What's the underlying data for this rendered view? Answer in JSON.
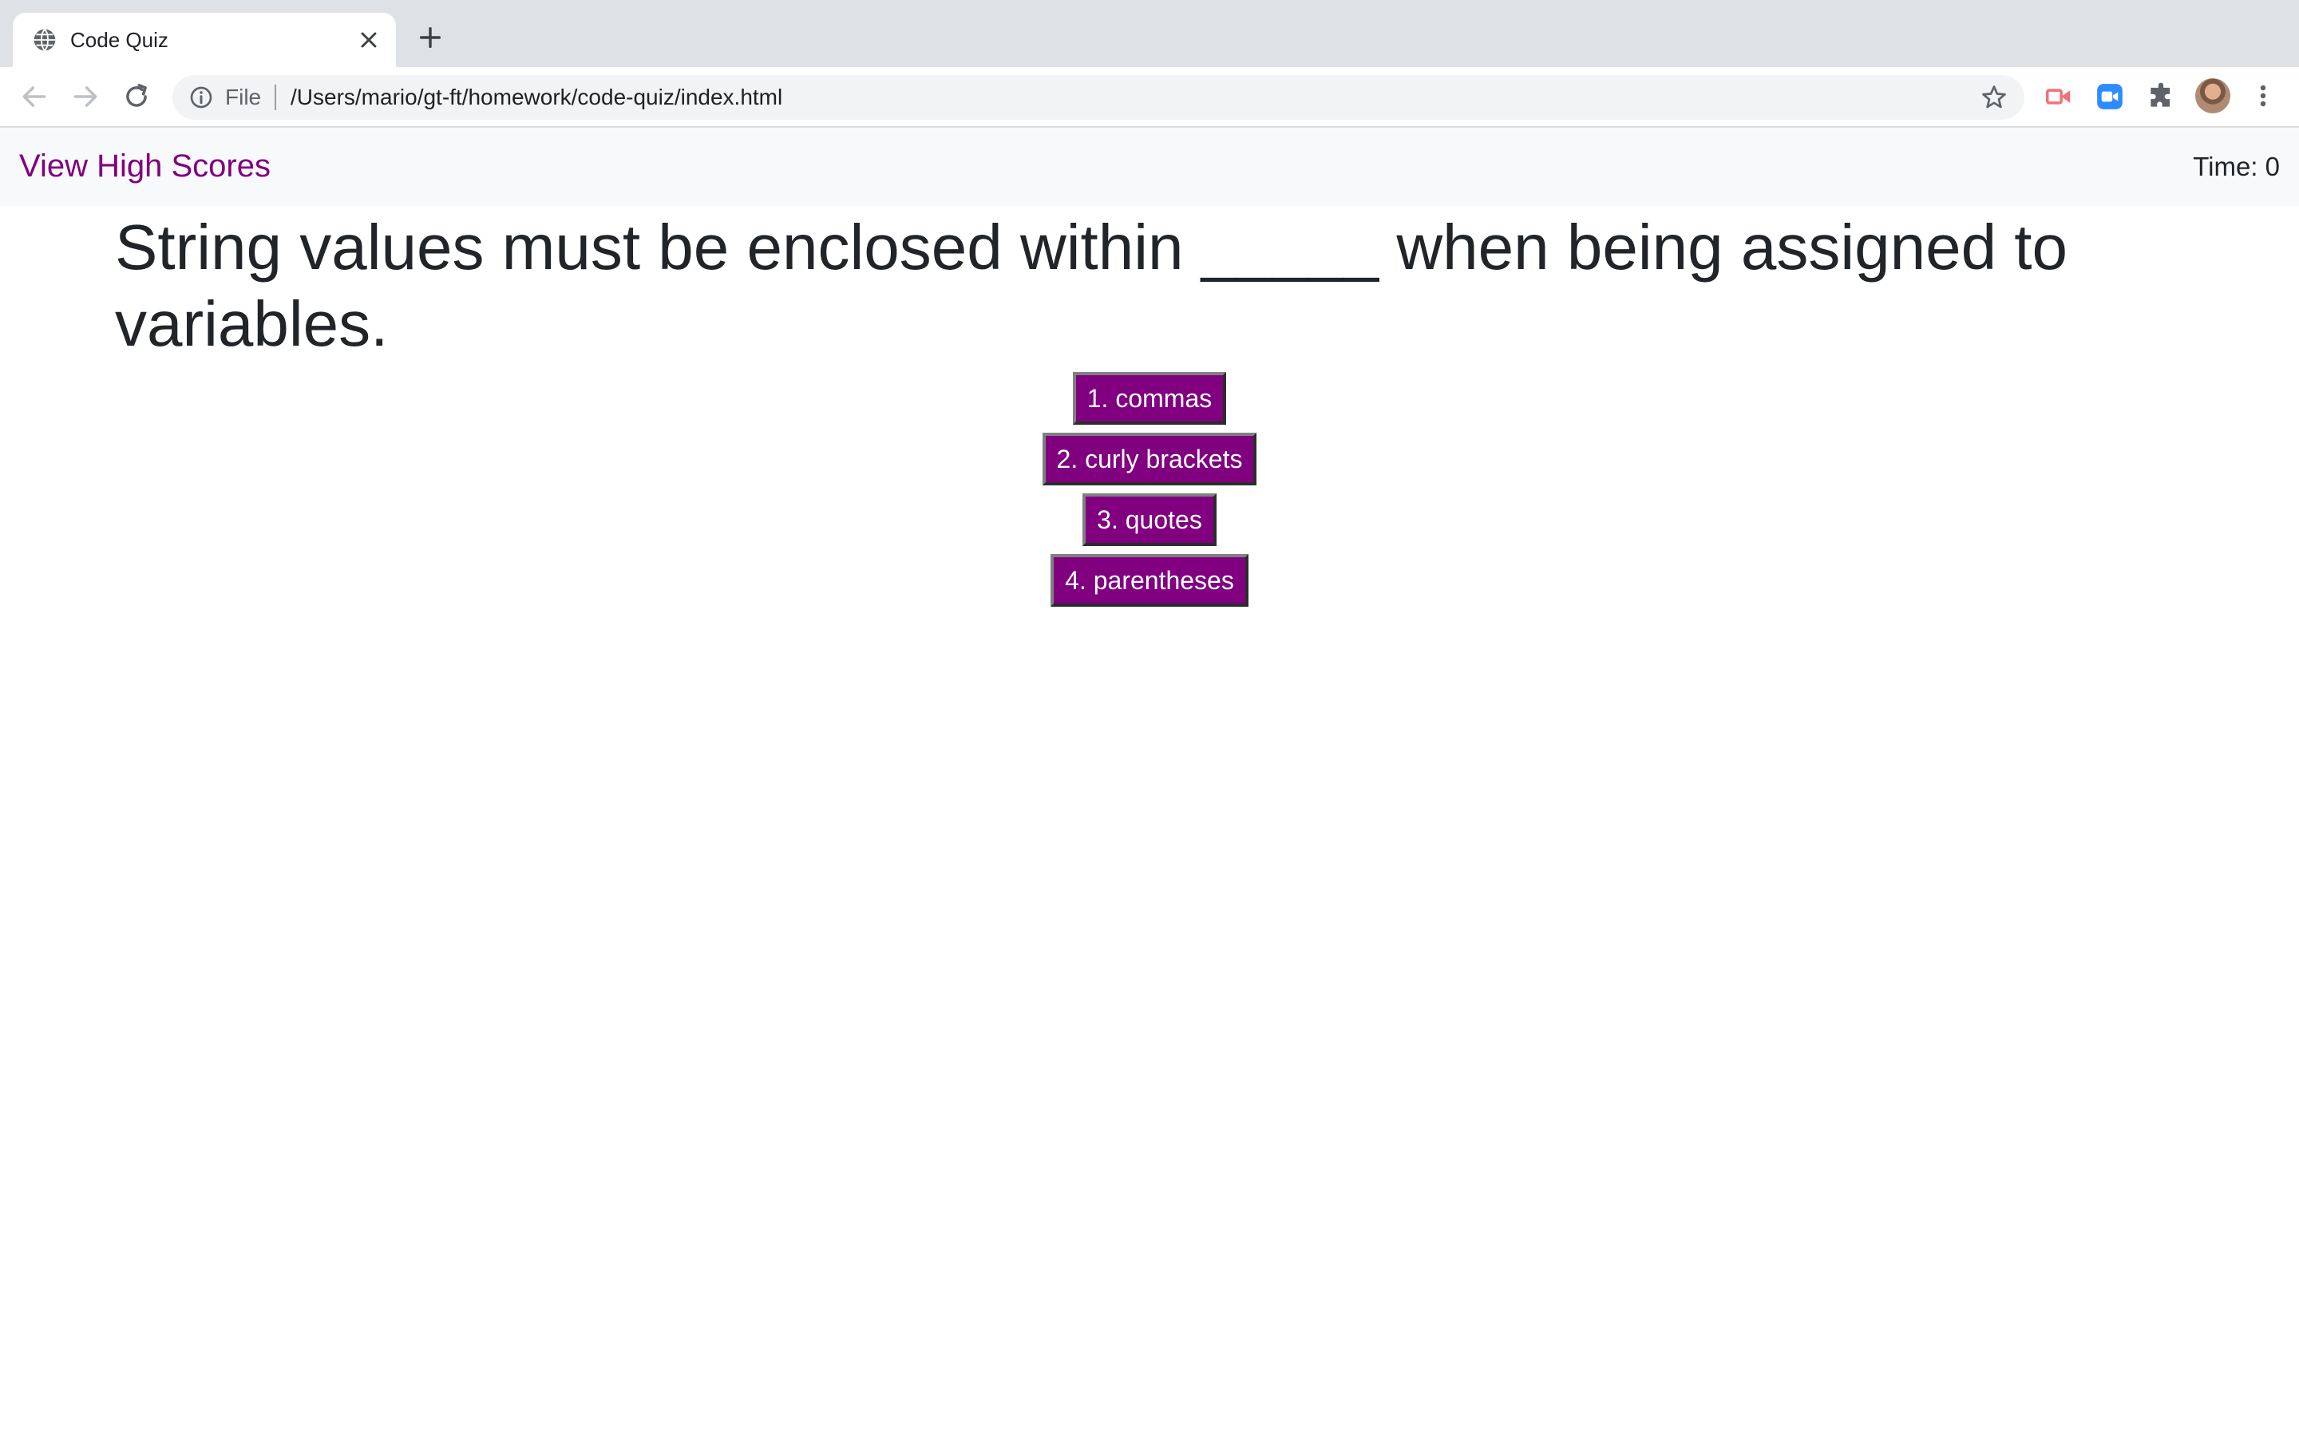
{
  "browser": {
    "tab_title": "Code Quiz",
    "url_scheme": "File",
    "url": "/Users/mario/gt-ft/homework/code-quiz/index.html",
    "icons": [
      "globe-icon",
      "close-icon",
      "plus-icon",
      "back-arrow-icon",
      "forward-arrow-icon",
      "reload-icon",
      "info-icon",
      "star-icon",
      "screencast-extension-icon",
      "zoom-extension-icon",
      "puzzle-extension-icon",
      "avatar",
      "more-vert-icon"
    ]
  },
  "header": {
    "high_scores_label": "View High Scores",
    "timer_label": "Time: 0"
  },
  "quiz": {
    "question": "String values must be enclosed within _____ when being assigned to variables.",
    "answers": [
      {
        "label": "1. commas"
      },
      {
        "label": "2. curly brackets"
      },
      {
        "label": "3. quotes"
      },
      {
        "label": "4. parentheses"
      }
    ]
  },
  "colors": {
    "accent": "#800080",
    "navbar_bg": "#f8f9fa",
    "text": "#212529",
    "tabbar_bg": "#dee1e6"
  }
}
